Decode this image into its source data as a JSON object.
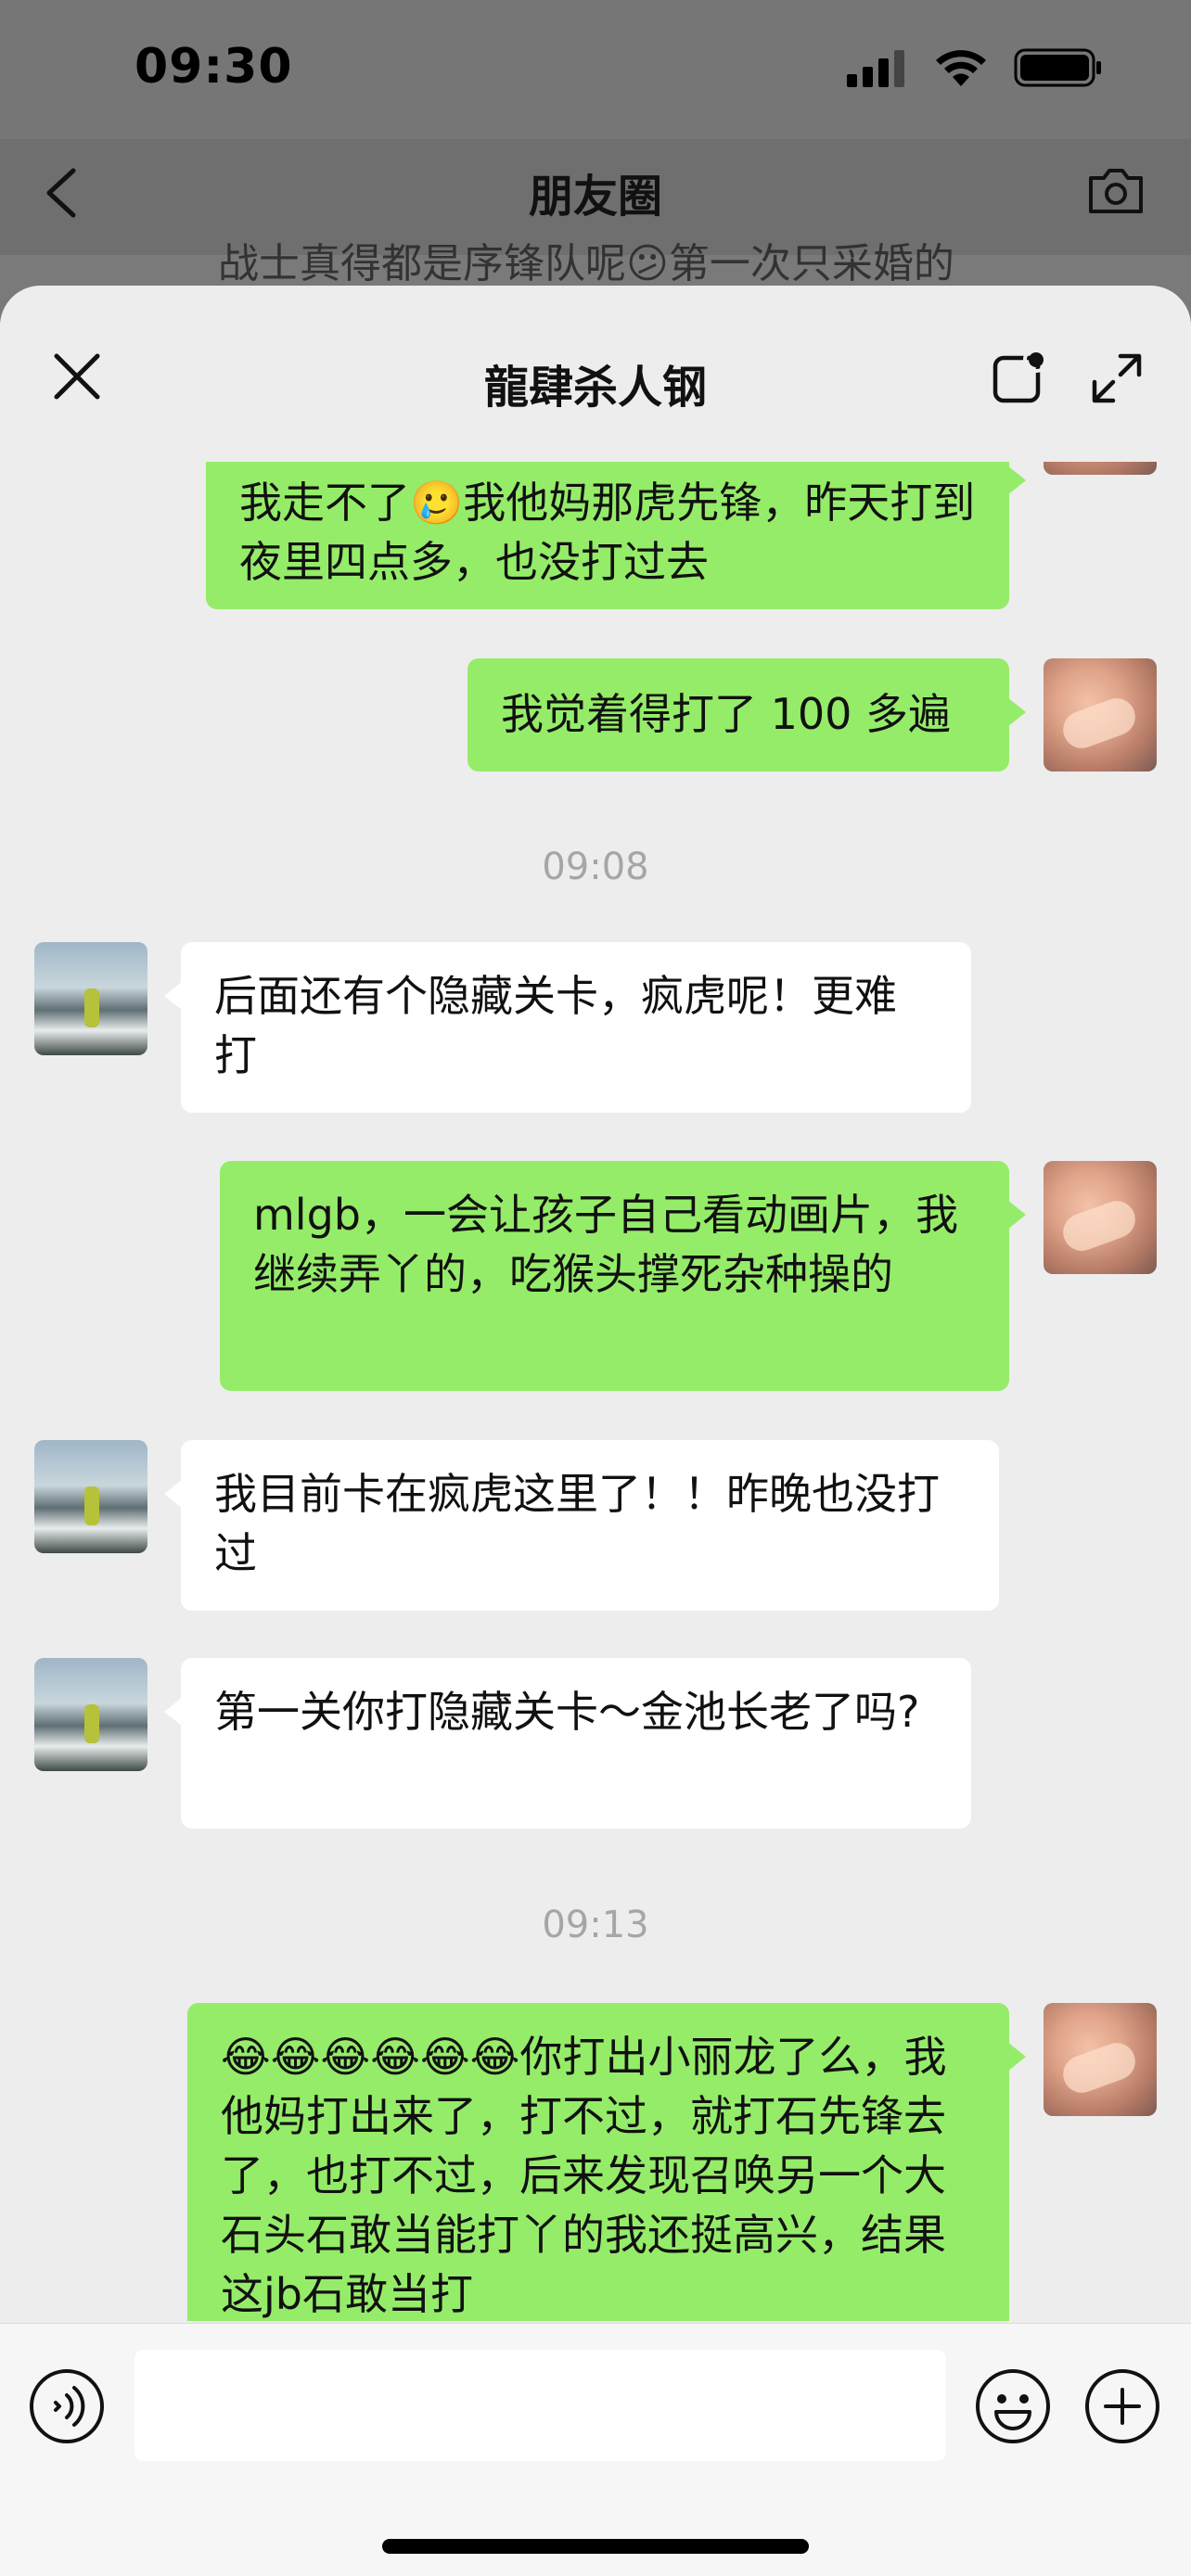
{
  "status_bar": {
    "time": "09:30"
  },
  "moments_header": {
    "title": "朋友圈",
    "peek_text": "战士真得都是序锋队呢😕第一次只采婚的"
  },
  "sheet": {
    "title": "龍肆杀人钢"
  },
  "messages": [
    {
      "type": "text",
      "side": "me",
      "text": "我走不了🥲我他妈那虎先锋，昨天打到夜里四点多，也没打过去"
    },
    {
      "type": "text",
      "side": "me",
      "text": "我觉着得打了 100 多遍"
    },
    {
      "type": "time",
      "text": "09:08"
    },
    {
      "type": "text",
      "side": "friend",
      "text": "后面还有个隐藏关卡，疯虎呢！更难打"
    },
    {
      "type": "text",
      "side": "me",
      "text": "mlgb，一会让孩子自己看动画片，我继续弄丫的，吃猴头撑死杂种操的"
    },
    {
      "type": "text",
      "side": "friend",
      "text": "我目前卡在疯虎这里了！！昨晚也没打过"
    },
    {
      "type": "text",
      "side": "friend",
      "text": "第一关你打隐藏关卡～金池长老了吗?"
    },
    {
      "type": "time",
      "text": "09:13"
    },
    {
      "type": "text",
      "side": "me",
      "text": "😂😂😂😂😂😂你打出小丽龙了么，我他妈打出来了，打不过，就打石先锋去了，也打不过，后来发现召唤另一个大石头石敢当能打丫的我还挺高兴，结果这jb石敢当打"
    }
  ],
  "input": {
    "value": "",
    "placeholder": ""
  },
  "colors": {
    "bubble_me": "#95ec69",
    "bubble_friend": "#ffffff",
    "chat_bg": "#ededed"
  },
  "icons": [
    "back-icon",
    "camera-icon",
    "close-icon",
    "open-window-icon",
    "expand-icon",
    "voice-icon",
    "emoji-icon",
    "plus-icon"
  ]
}
